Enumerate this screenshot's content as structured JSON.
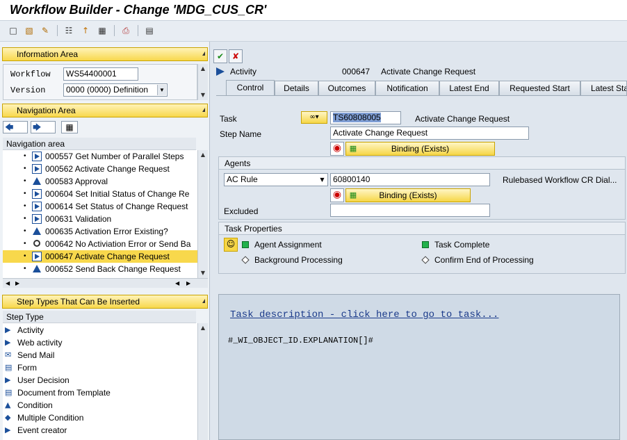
{
  "window": {
    "title": "Workflow Builder - Change 'MDG_CUS_CR'"
  },
  "toolbar": {
    "icons": [
      "new-icon",
      "open-icon",
      "settings-icon",
      "org-icon",
      "pin-icon",
      "grid-icon",
      "print-icon",
      "list-icon"
    ]
  },
  "info_area": {
    "title": "Information Area",
    "workflow_label": "Workflow",
    "workflow_value": "WS54400001",
    "version_label": "Version",
    "version_value": "0000 (0000) Definition"
  },
  "nav_area": {
    "title": "Navigation Area",
    "header": "Navigation area",
    "items": [
      {
        "label": "000557 Get Number of Parallel Steps",
        "icon": "activity"
      },
      {
        "label": "000562 Activate Change Request",
        "icon": "activity"
      },
      {
        "label": "000583 Approval",
        "icon": "decision"
      },
      {
        "label": "000604 Set Initial Status of Change Re",
        "icon": "activity"
      },
      {
        "label": "000614 Set Status of Change Request",
        "icon": "activity"
      },
      {
        "label": "000631 Validation",
        "icon": "activity"
      },
      {
        "label": "000635 Activation Error Existing?",
        "icon": "decision"
      },
      {
        "label": "000642 No Activiation Error or Send Ba",
        "icon": "condition"
      },
      {
        "label": "000647 Activate Change Request",
        "icon": "activity",
        "selected": true
      },
      {
        "label": "000652 Send Back Change Request",
        "icon": "decision"
      }
    ]
  },
  "step_types": {
    "title": "Step Types That Can Be Inserted",
    "header": "Step Type",
    "items": [
      {
        "label": "Activity"
      },
      {
        "label": "Web activity"
      },
      {
        "label": "Send Mail"
      },
      {
        "label": "Form"
      },
      {
        "label": "User Decision"
      },
      {
        "label": "Document from Template"
      },
      {
        "label": "Condition"
      },
      {
        "label": "Multiple Condition"
      },
      {
        "label": "Event creator"
      }
    ]
  },
  "step": {
    "type_label": "Activity",
    "number": "000647",
    "name": "Activate Change Request"
  },
  "tabs": [
    {
      "label": "Control",
      "active": true
    },
    {
      "label": "Details"
    },
    {
      "label": "Outcomes"
    },
    {
      "label": "Notification"
    },
    {
      "label": "Latest End"
    },
    {
      "label": "Requested Start"
    },
    {
      "label": "Latest Sta"
    }
  ],
  "control": {
    "task_label": "Task",
    "task_value": "TS60808005",
    "task_text": "Activate Change Request",
    "step_name_label": "Step Name",
    "step_name_value": "Activate Change Request",
    "binding_label": "Binding (Exists)",
    "agents": {
      "title": "Agents",
      "type_value": "AC Rule",
      "rule_value": "60800140",
      "rule_text": "Rulebased Workflow CR Dial...",
      "binding_label": "Binding (Exists)",
      "excluded_label": "Excluded",
      "excluded_value": ""
    },
    "task_properties": {
      "title": "Task Properties",
      "agent_assignment": "Agent Assignment",
      "task_complete": "Task Complete",
      "background_processing": "Background Processing",
      "confirm_end": "Confirm End of Processing"
    }
  },
  "description": {
    "link": "Task description - click here to go to task...",
    "text": "#_WI_OBJECT_ID.EXPLANATION[]#"
  }
}
